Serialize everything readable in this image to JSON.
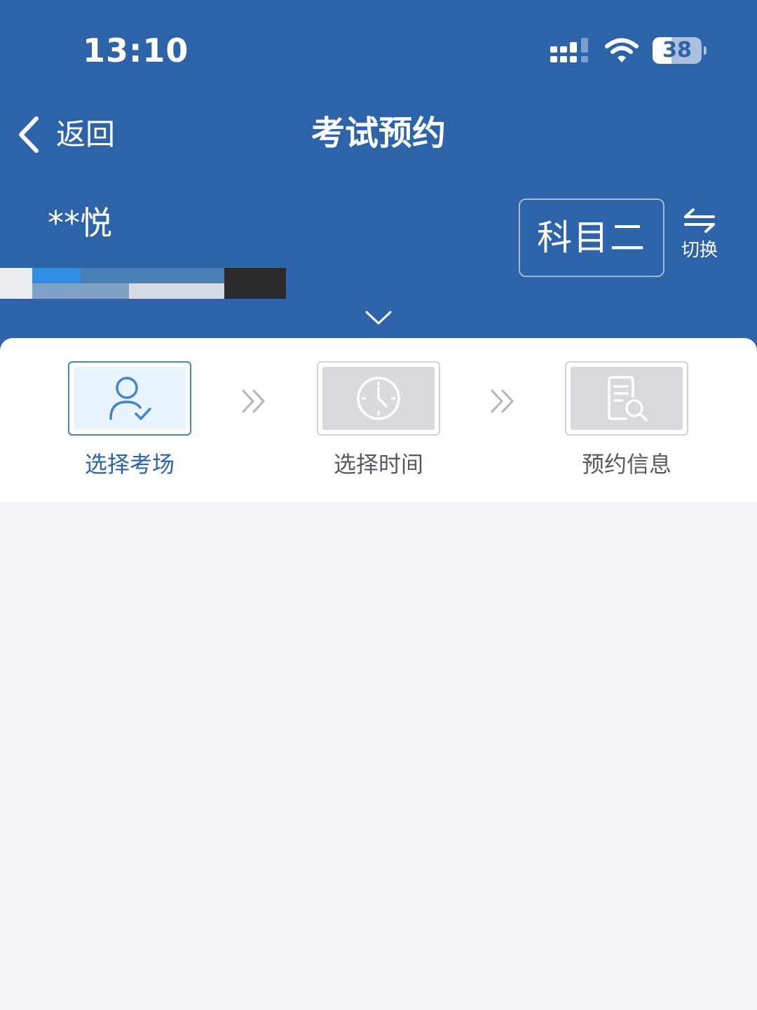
{
  "status_bar": {
    "time": "13:10",
    "battery_level": "38",
    "icons": [
      "signal-icon",
      "wifi-icon",
      "battery-icon"
    ]
  },
  "nav": {
    "back_label": "返回",
    "title": "考试预约",
    "icons": [
      "chevron-left-icon"
    ]
  },
  "profile": {
    "name": "**悦",
    "subject": "科目二",
    "switch_label": "切换",
    "icons": [
      "swap-icon",
      "chevron-down-icon"
    ]
  },
  "steps": [
    {
      "label": "选择考场",
      "icon": "user-check-icon",
      "active": true
    },
    {
      "label": "选择时间",
      "icon": "clock-icon",
      "active": false
    },
    {
      "label": "预约信息",
      "icon": "document-search-icon",
      "active": false
    }
  ],
  "colors": {
    "header_bg": "#2d64a9",
    "active_accent": "#3f86cf",
    "page_bg": "#f3f4f9",
    "inactive_box": "#d7d9de"
  }
}
